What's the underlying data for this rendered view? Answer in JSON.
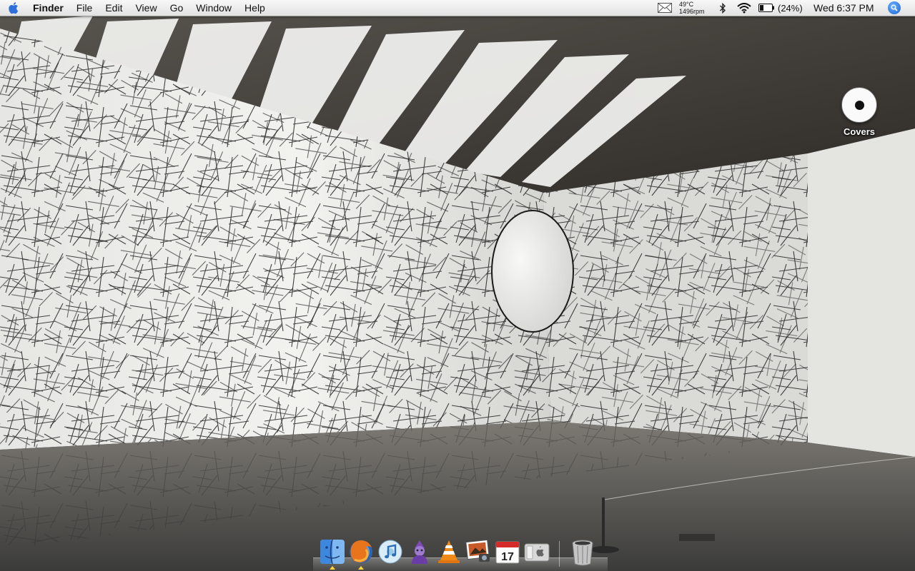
{
  "menubar": {
    "app_name": "Finder",
    "items": [
      "File",
      "Edit",
      "View",
      "Go",
      "Window",
      "Help"
    ],
    "status": {
      "cpu_temp": "49°C",
      "fan_speed": "1496rpm",
      "battery_percent": "(24%)",
      "clock": "Wed 6:37 PM"
    }
  },
  "desktop": {
    "icons": [
      {
        "label": "Covers",
        "icon": "cd-disc-icon"
      }
    ]
  },
  "dock": {
    "apps": [
      {
        "icon": "finder-icon",
        "running": true
      },
      {
        "icon": "firefox-icon",
        "running": true
      },
      {
        "icon": "itunes-icon",
        "running": false
      },
      {
        "icon": "adium-icon",
        "running": false
      },
      {
        "icon": "vlc-icon",
        "running": false
      },
      {
        "icon": "iphoto-icon",
        "running": false
      },
      {
        "icon": "ical-icon",
        "date": "17",
        "running": false
      },
      {
        "icon": "system-preferences-icon",
        "running": false
      }
    ],
    "trash": {
      "icon": "trash-icon"
    }
  },
  "colors": {
    "spotlight": "#1763d1",
    "menubar": "#ececec",
    "dock_indicator": "#ffd23a"
  }
}
